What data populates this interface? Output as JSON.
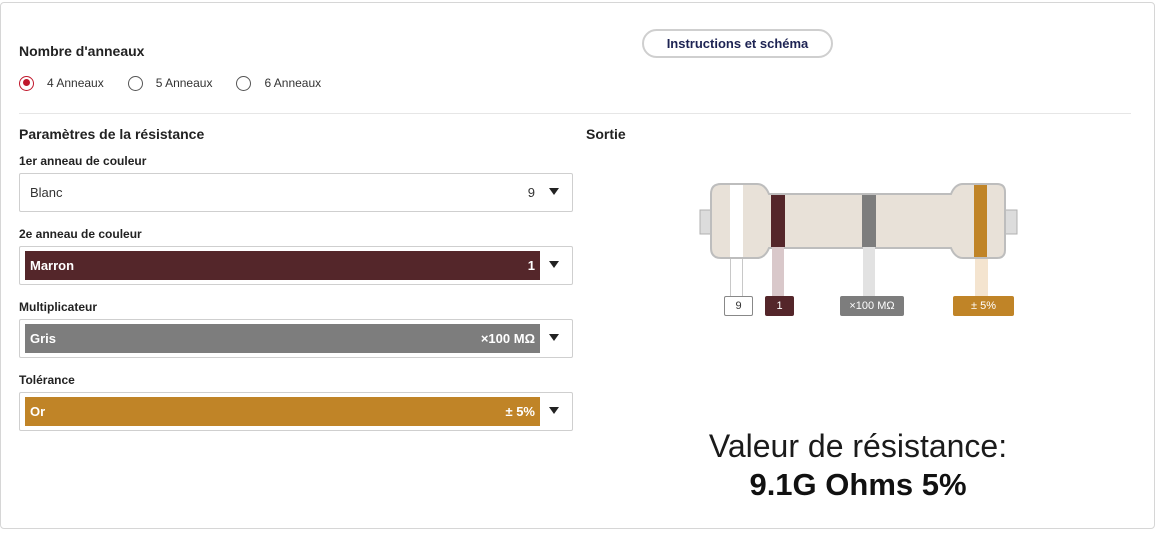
{
  "rings_section": {
    "title": "Nombre d'anneaux",
    "options": [
      {
        "label": "4 Anneaux",
        "checked": true
      },
      {
        "label": "5 Anneaux",
        "checked": false
      },
      {
        "label": "6 Anneaux",
        "checked": false
      }
    ]
  },
  "instructions_button": "Instructions et schéma",
  "params": {
    "title": "Paramètres de la résistance",
    "fields": [
      {
        "label": "1er anneau de couleur",
        "color_name": "Blanc",
        "value": "9",
        "color": "#ffffff"
      },
      {
        "label": "2e anneau de couleur",
        "color_name": "Marron",
        "value": "1",
        "color": "#54262a"
      },
      {
        "label": "Multiplicateur",
        "color_name": "Gris",
        "value": "×100 MΩ",
        "color": "#7d7d7d"
      },
      {
        "label": "Tolérance",
        "color_name": "Or",
        "value": "± 5%",
        "color": "#c08427"
      }
    ]
  },
  "output": {
    "title": "Sortie",
    "ring_labels": [
      "9",
      "1",
      "×100 MΩ",
      "± 5%"
    ],
    "result_heading": "Valeur de résistance:",
    "result_value": "9.1G Ohms 5%"
  },
  "colors": {
    "accent_red": "#c0182c",
    "resistor_body": "#e8e1d8",
    "resistor_outline": "#bdbdbd",
    "brown": "#54262a",
    "gray": "#7d7d7d",
    "gold": "#c08427"
  }
}
